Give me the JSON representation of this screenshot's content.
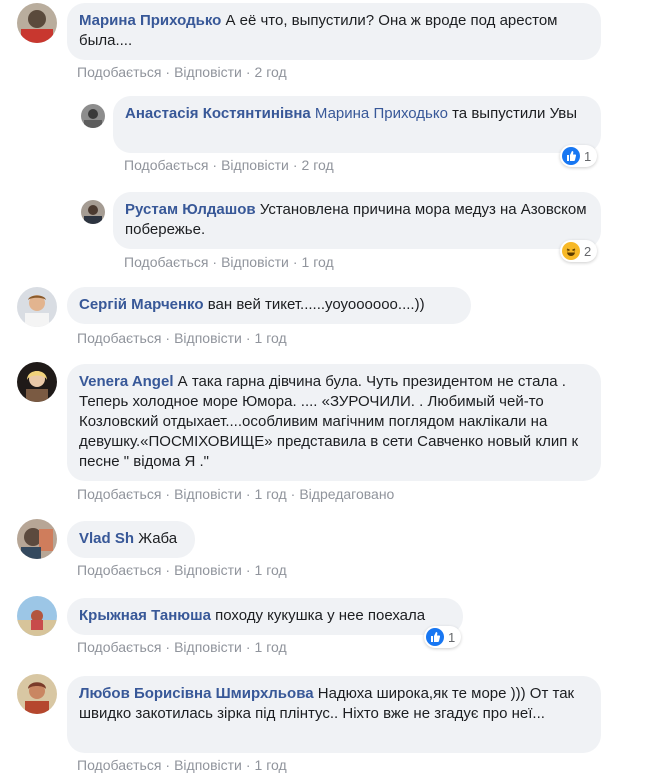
{
  "actions": {
    "like": "Подобається",
    "reply": "Відповісти",
    "dot": "·",
    "edited": "Відредаговано"
  },
  "comments": [
    {
      "author": "Марина Приходько",
      "text": "А её что, выпустили? Она ж вроде под арестом была....",
      "time": "2 год"
    },
    {
      "author": "Анастасія Костянтинівна",
      "mention": "Марина Приходько",
      "text": "та выпустили Увы",
      "time": "2 год",
      "reactions": "1"
    },
    {
      "author": "Рустам Юлдашов",
      "text": "Установлена причина мора медуз на Азовском побережье.",
      "time": "1 год",
      "reactions": "2"
    },
    {
      "author": "Сергій Марченко",
      "text": "ван вей тикет......уоуоооооо....))",
      "time": "1 год"
    },
    {
      "author": "Venera Angel",
      "text": "А така гарна дівчина була. Чуть президентом не стала . Теперь холодное море Юмора. .... «ЗУРОЧИЛИ. . Любимый чей-то Козловский отдыхает....особливим магічним поглядом наклікали на девушку.«ПОСМІХОВИЩЕ» представила в сети Савченко новый клип к песне \" відома Я .\"",
      "time": "1 год"
    },
    {
      "author": "Vlad Sh",
      "text": "Жаба",
      "time": "1 год"
    },
    {
      "author": "Крыжная Танюша",
      "text": "походу кукушка у нее поехала",
      "time": "1 год",
      "reactions": "1"
    },
    {
      "author": "Любов Борисівна Шмирхльова",
      "text": "Надюха широка,як те море ))) От так швидко закотилась зірка під плінтус.. Ніхто вже не згадує про неї...",
      "time": "1 год"
    }
  ],
  "colors": {
    "author": "#385898",
    "bubble": "#f0f2f5",
    "meta": "#90949c",
    "like": "#1877f2",
    "haha": "#f7b928"
  }
}
